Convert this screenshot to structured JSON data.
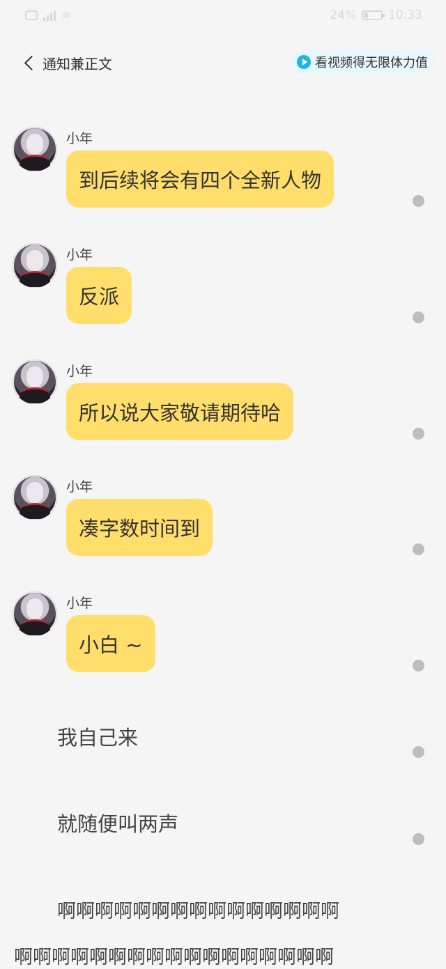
{
  "status_bar": {
    "battery_percent": "24%",
    "battery_level": 0.24,
    "time": "10:33"
  },
  "nav": {
    "back_label": "通知兼正文",
    "video_label": "看视频得无限体力值"
  },
  "messages": [
    {
      "sender": "小年",
      "text": "到后续将会有四个全新人物"
    },
    {
      "sender": "小年",
      "text": "反派"
    },
    {
      "sender": "小年",
      "text": "所以说大家敬请期待哈"
    },
    {
      "sender": "小年",
      "text": "凑字数时间到"
    },
    {
      "sender": "小年",
      "text": "小白 ~"
    }
  ],
  "narration": [
    {
      "text": "我自己来"
    },
    {
      "text": "就随便叫两声"
    }
  ],
  "ah_lines": [
    "啊啊啊啊啊啊啊啊啊啊啊啊啊啊啊",
    "啊啊啊啊啊啊啊啊啊啊啊啊啊啊啊啊啊"
  ]
}
